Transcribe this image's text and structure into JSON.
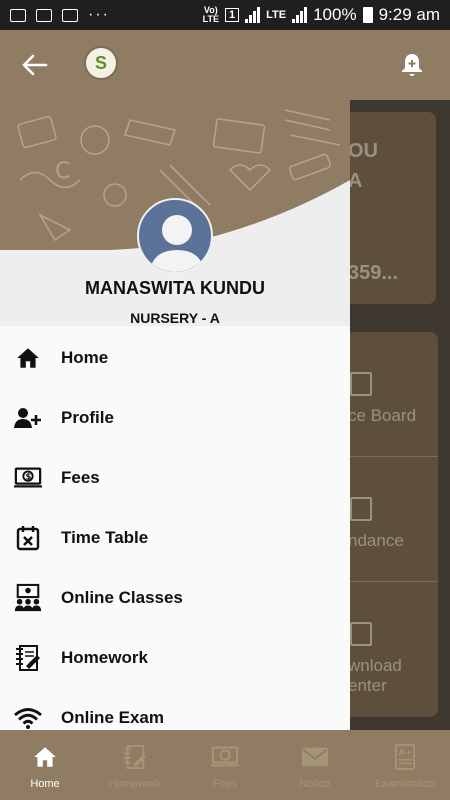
{
  "status_bar": {
    "network_label": "LTE",
    "sim_label": "1",
    "network_label_2": "LTE",
    "battery": "100%",
    "time": "9:29 am",
    "dots": "···"
  },
  "app_bar": {
    "back_icon": "arrow-left-icon",
    "logo_letter": "S",
    "bell_icon": "bell-add-icon"
  },
  "dashboard": {
    "card_text_1": "OU",
    "card_text_2": "A",
    "card_text_3": "359...",
    "tiles": [
      {
        "label": "ce Board",
        "icon": "notice-icon"
      },
      {
        "label": "ndance",
        "icon": "attendance-icon"
      },
      {
        "label": "wnload",
        "label2": "enter",
        "icon": "download-icon"
      }
    ]
  },
  "drawer": {
    "student_name": "MANASWITA KUNDU",
    "student_class": "NURSERY - A",
    "menu": [
      {
        "label": "Home",
        "icon": "home-icon"
      },
      {
        "label": "Profile",
        "icon": "add-person-icon"
      },
      {
        "label": "Fees",
        "icon": "fees-icon"
      },
      {
        "label": "Time Table",
        "icon": "calendar-icon"
      },
      {
        "label": "Online Classes",
        "icon": "classroom-icon"
      },
      {
        "label": "Homework",
        "icon": "homework-icon"
      },
      {
        "label": "Online Exam",
        "icon": "wifi-icon"
      }
    ]
  },
  "bottom_nav": [
    {
      "label": "Home",
      "icon": "home-icon",
      "active": true
    },
    {
      "label": "Homework",
      "icon": "homework-icon",
      "active": false
    },
    {
      "label": "Fees",
      "icon": "fees-icon",
      "active": false
    },
    {
      "label": "Notice",
      "icon": "mail-icon",
      "active": false
    },
    {
      "label": "Examination",
      "icon": "exam-icon",
      "active": false
    }
  ],
  "colors": {
    "brand": "#8f7c62",
    "drawer_bg": "#fafafa",
    "status_bar": "#1f1f1f"
  }
}
